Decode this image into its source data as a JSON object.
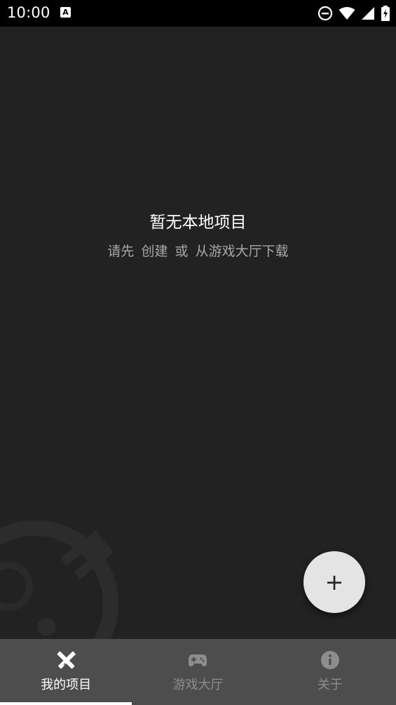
{
  "status_bar": {
    "time": "10:00",
    "notification_glyph": "A",
    "icons": [
      "do-not-disturb-icon",
      "wifi-icon",
      "signal-icon",
      "battery-charging-icon"
    ]
  },
  "empty_state": {
    "title": "暂无本地项目",
    "hint_part1": "请先",
    "hint_part2": "创建",
    "hint_part3": "或",
    "hint_part4": "从游戏大厅下载"
  },
  "fab": {
    "symbol": "+",
    "icon": "add-icon"
  },
  "bottom_nav": {
    "items": [
      {
        "label": "我的项目",
        "icon": "pencil-ruler-icon",
        "active": true
      },
      {
        "label": "游戏大厅",
        "icon": "gamepad-icon",
        "active": false
      },
      {
        "label": "关于",
        "icon": "info-icon",
        "active": false
      }
    ]
  },
  "colors": {
    "background": "#222222",
    "status_bar": "#000000",
    "nav_bar": "#4d4d4d",
    "fab": "#e4e4e4",
    "active_label": "#ffffff",
    "inactive_label": "#8d8d8d"
  }
}
